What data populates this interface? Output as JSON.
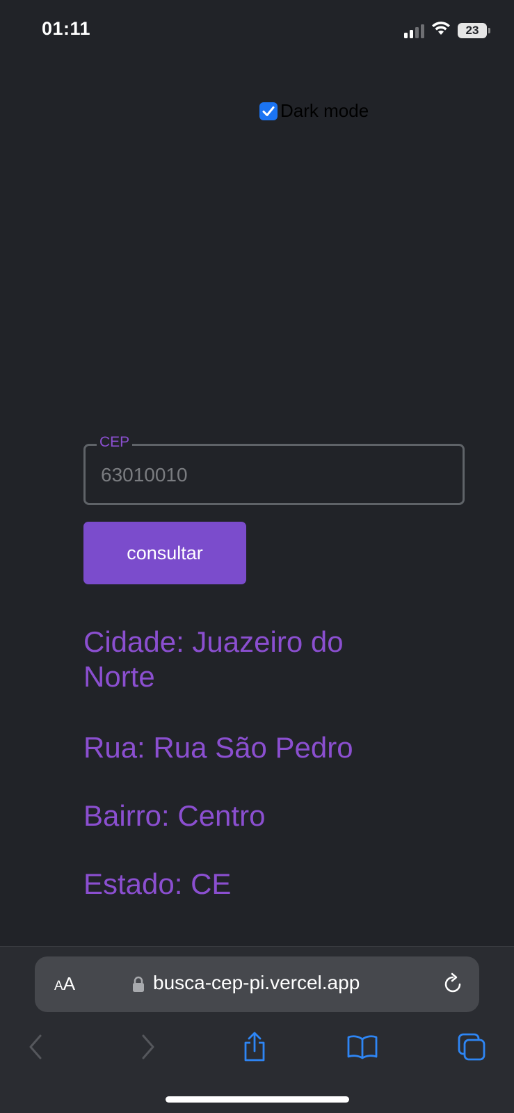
{
  "status_bar": {
    "time": "01:11",
    "battery_level": "23"
  },
  "dark_mode": {
    "label": "Dark mode",
    "checked": true
  },
  "form": {
    "cep_label": "CEP",
    "cep_value": "63010010",
    "submit_label": "consultar"
  },
  "results": {
    "cidade": "Cidade: Juazeiro do Norte",
    "rua": "Rua: Rua São Pedro",
    "bairro": "Bairro: Centro",
    "estado": "Estado: CE"
  },
  "browser": {
    "text_size_label_small": "A",
    "text_size_label_large": "A",
    "url": "busca-cep-pi.vercel.app"
  },
  "colors": {
    "background": "#212328",
    "accent": "#7b4ccc",
    "result_text": "#8b4fd0",
    "checkbox": "#1b74f3"
  },
  "icons": [
    "signal-icon",
    "wifi-icon",
    "battery-icon",
    "lock-icon",
    "reload-icon",
    "back-icon",
    "forward-icon",
    "share-icon",
    "bookmarks-icon",
    "tabs-icon"
  ]
}
